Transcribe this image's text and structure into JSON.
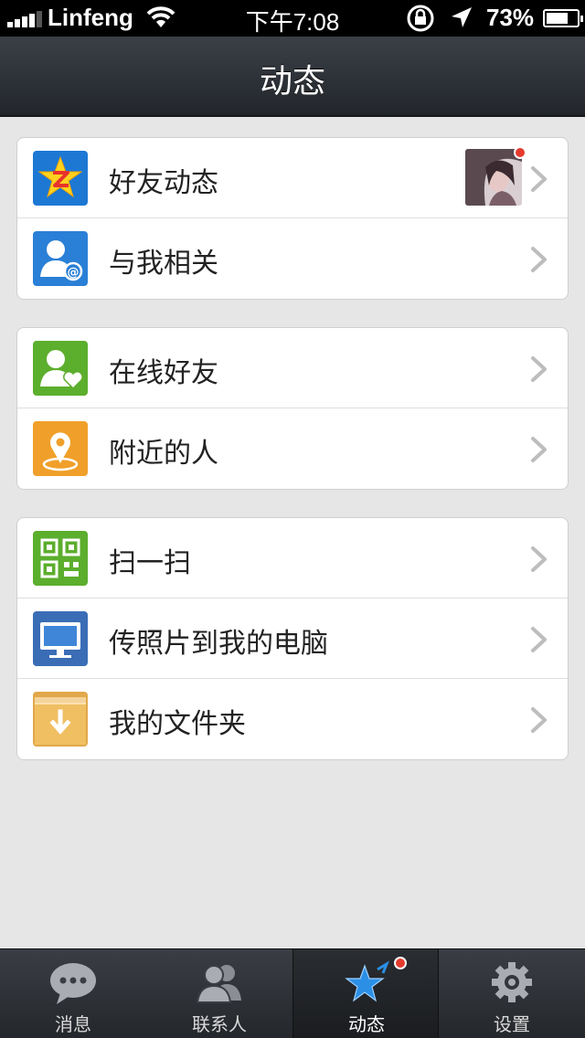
{
  "status_bar": {
    "carrier": "Linfeng",
    "time": "下午7:08",
    "battery": "73%",
    "battery_level": 0.73
  },
  "nav": {
    "title": "动态"
  },
  "groups": [
    {
      "items": [
        {
          "label": "好友动态",
          "icon": "qzone-star-icon",
          "color": "#1d78d4",
          "has_thumbnail": true,
          "has_badge": true
        },
        {
          "label": "与我相关",
          "icon": "person-at-icon",
          "color": "#2a7fd6"
        }
      ]
    },
    {
      "items": [
        {
          "label": "在线好友",
          "icon": "person-heart-icon",
          "color": "#5cae2d"
        },
        {
          "label": "附近的人",
          "icon": "location-pin-icon",
          "color": "#f0a02a"
        }
      ]
    },
    {
      "items": [
        {
          "label": "扫一扫",
          "icon": "qr-code-icon",
          "color": "#5cae2d"
        },
        {
          "label": "传照片到我的电脑",
          "icon": "computer-monitor-icon",
          "color": "#3a6db5"
        },
        {
          "label": "我的文件夹",
          "icon": "folder-download-icon",
          "color": "#e2a84a"
        }
      ]
    }
  ],
  "tab_bar": {
    "tabs": [
      {
        "label": "消息",
        "icon": "chat-bubble-icon"
      },
      {
        "label": "联系人",
        "icon": "contacts-icon"
      },
      {
        "label": "动态",
        "icon": "star-icon",
        "active": true,
        "has_badge": true
      },
      {
        "label": "设置",
        "icon": "gear-icon"
      }
    ]
  }
}
